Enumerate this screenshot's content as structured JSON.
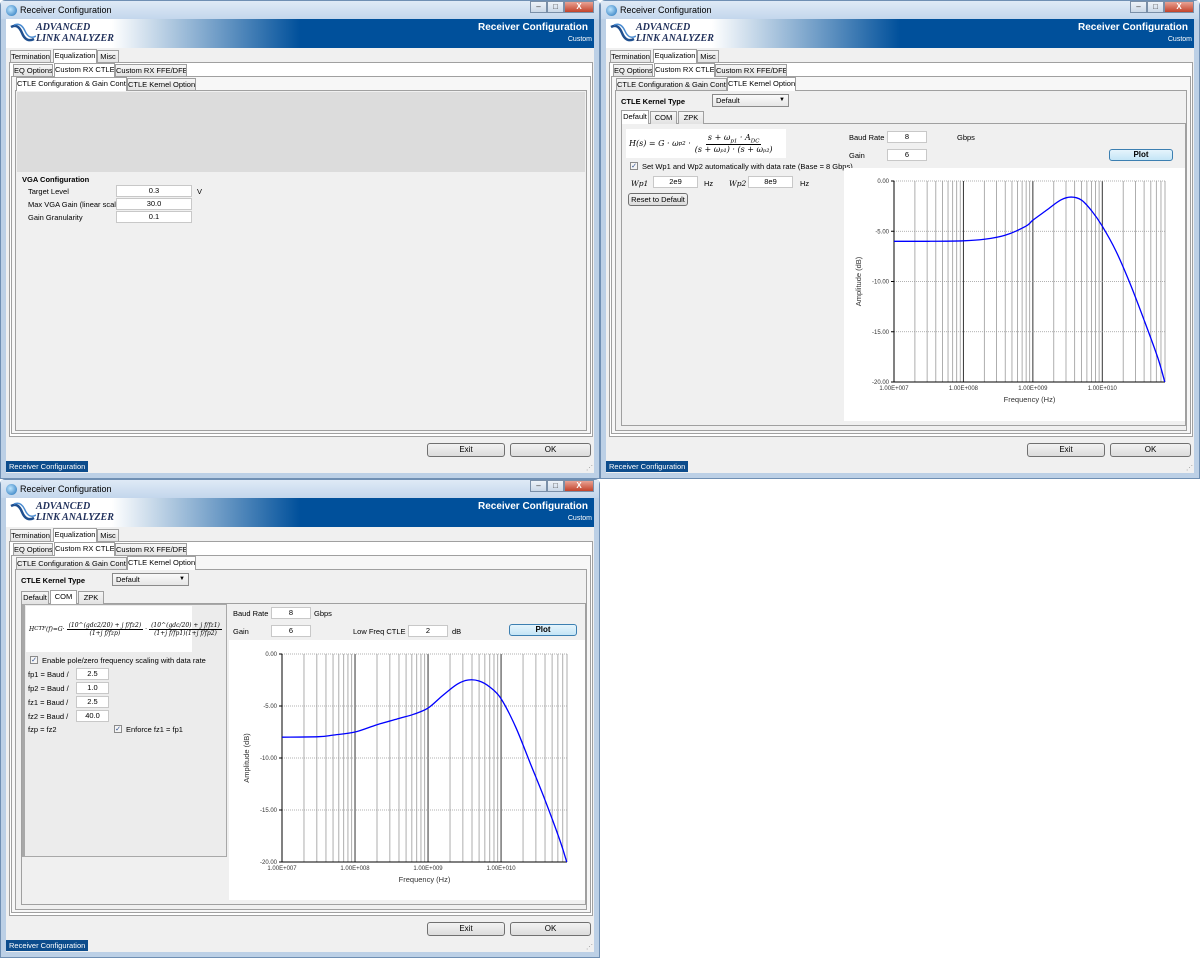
{
  "app": {
    "window_title": "Receiver Configuration",
    "logo_line1": "ADVANCED",
    "logo_line2": "LINK ANALYZER",
    "banner_title": "Receiver Configuration",
    "banner_subtitle": "Custom",
    "window_buttons": {
      "minimize": "–",
      "maximize": "□",
      "close": "X"
    },
    "tabs": [
      "Termination",
      "Equalization",
      "Misc"
    ],
    "eq_tabs": [
      "EQ Options",
      "Custom RX CTLE",
      "Custom RX FFE/DFE"
    ],
    "ctle_tabs": [
      "CTLE Configuration & Gain Control",
      "CTLE Kernel Options"
    ],
    "exit": "Exit",
    "ok": "OK",
    "status": "Receiver Configuration"
  },
  "vga": {
    "heading": "VGA Configuration",
    "fields": [
      {
        "label": "Target Level",
        "value": "0.3",
        "unit": "V"
      },
      {
        "label": "Max VGA Gain (linear scale)",
        "value": "30.0"
      },
      {
        "label": "Gain Granularity",
        "value": "0.1"
      }
    ]
  },
  "kernel": {
    "label": "CTLE Kernel Type",
    "selected": "Default",
    "tabs": [
      "Default",
      "COM",
      "ZPK"
    ],
    "baud_label": "Baud Rate",
    "baud_value": "8",
    "baud_unit": "Gbps",
    "gain_label": "Gain",
    "gain_value": "6",
    "plot": "Plot"
  },
  "default_tab": {
    "formula_lhs": "H(s) = G · ω",
    "formula_lhs_sub": "p2",
    "formula_num": "s + ω",
    "formula_num_sub": "p1",
    "formula_num_tail": " · A",
    "formula_num_sub2": "DC",
    "formula_den": "(s + ωₚ₁) · (s + ωₚ₂)",
    "auto_checkbox": "Set Wp1 and Wp2 automatically with data rate (Base = 8 Gbps)",
    "auto_checked": true,
    "wp1_label": "Wp1",
    "wp1_value": "2e9",
    "wp2_label": "Wp2",
    "wp2_value": "8e9",
    "hz": "Hz",
    "reset": "Reset to Default"
  },
  "com_tab": {
    "formula_lhs": "H",
    "formula_lhs_sub": "CTF",
    "formula_lhs_tail": "(f)=G·",
    "frac1_num": "(10^(gdc2/20) + j f/fz2)",
    "frac1_den": "(1+j f/fzp)",
    "frac2_num": "(10^(gdc/20) + j f/fz1)",
    "frac2_den": "(1+j f/fp1)(1+j f/fp2)",
    "scaling_checkbox": "Enable pole/zero frequency scaling with data rate",
    "scaling_checked": true,
    "rows": [
      {
        "label": "fp1 = Baud /",
        "value": "2.5"
      },
      {
        "label": "fp2 = Baud /",
        "value": "1.0"
      },
      {
        "label": "fz1 = Baud /",
        "value": "2.5"
      },
      {
        "label": "fz2 = Baud /",
        "value": "40.0"
      }
    ],
    "fzp": "fzp = fz2",
    "enforce": "Enforce fz1 = fp1",
    "enforce_checked": true,
    "lowfreq_label": "Low Freq CTLE",
    "lowfreq_value": "2",
    "lowfreq_unit": "dB"
  },
  "chart_data": [
    {
      "type": "line",
      "title": "",
      "xlabel": "Frequency (Hz)",
      "ylabel": "Amplitude (dB)",
      "xscale": "log",
      "xlim": [
        10000000.0,
        80000000000.0
      ],
      "ylim": [
        -20,
        0
      ],
      "grid": true,
      "xticks": [
        10000000.0,
        100000000.0,
        1000000000.0,
        10000000000.0
      ],
      "xtick_labels": [
        "1.00E+007",
        "1.00E+008",
        "1.00E+009",
        "1.00E+010"
      ],
      "yticks": [
        0,
        -5,
        -10,
        -15,
        -20
      ],
      "ytick_labels": [
        "0.00",
        "-5.00",
        "-10.00",
        "-15.00",
        "-20.00"
      ],
      "series": [
        {
          "name": "Default CTLE",
          "color": "#0000ff",
          "x": [
            10000000.0,
            31600000.0,
            100000000.0,
            200000000.0,
            398000000.0,
            794000000.0,
            1000000000.0,
            1580000000.0,
            2510000000.0,
            3550000000.0,
            5010000000.0,
            7080000000.0,
            10000000000.0,
            15800000000.0,
            25100000000.0,
            39800000000.0,
            63100000000.0,
            79400000000.0
          ],
          "y": [
            -6.0,
            -6.0,
            -5.95,
            -5.8,
            -5.4,
            -4.5,
            -3.9,
            -2.9,
            -1.9,
            -1.6,
            -1.9,
            -3.0,
            -4.5,
            -7.0,
            -10.2,
            -13.8,
            -17.6,
            -20.0
          ]
        }
      ]
    },
    {
      "type": "line",
      "title": "",
      "xlabel": "Frequency (Hz)",
      "ylabel": "Amplitude (dB)",
      "xscale": "log",
      "xlim": [
        10000000.0,
        80000000000.0
      ],
      "ylim": [
        -20,
        0
      ],
      "grid": true,
      "xticks": [
        10000000.0,
        100000000.0,
        1000000000.0,
        10000000000.0
      ],
      "xtick_labels": [
        "1.00E+007",
        "1.00E+008",
        "1.00E+009",
        "1.00E+010"
      ],
      "yticks": [
        0,
        -5,
        -10,
        -15,
        -20
      ],
      "ytick_labels": [
        "0.00",
        "-5.00",
        "-10.00",
        "-15.00",
        "-20.00"
      ],
      "series": [
        {
          "name": "COM CTLE",
          "color": "#0000ff",
          "x": [
            10000000.0,
            31600000.0,
            50100000.0,
            100000000.0,
            200000000.0,
            398000000.0,
            631000000.0,
            1000000000.0,
            1580000000.0,
            2510000000.0,
            3550000000.0,
            5010000000.0,
            7080000000.0,
            10000000000.0,
            15800000000.0,
            25100000000.0,
            39800000000.0,
            63100000000.0,
            79400000000.0
          ],
          "y": [
            -8.0,
            -7.95,
            -7.8,
            -7.5,
            -6.8,
            -6.2,
            -5.8,
            -5.2,
            -4.0,
            -2.9,
            -2.5,
            -2.6,
            -3.2,
            -4.3,
            -7.0,
            -10.5,
            -14.0,
            -17.8,
            -20.0
          ]
        }
      ]
    }
  ]
}
